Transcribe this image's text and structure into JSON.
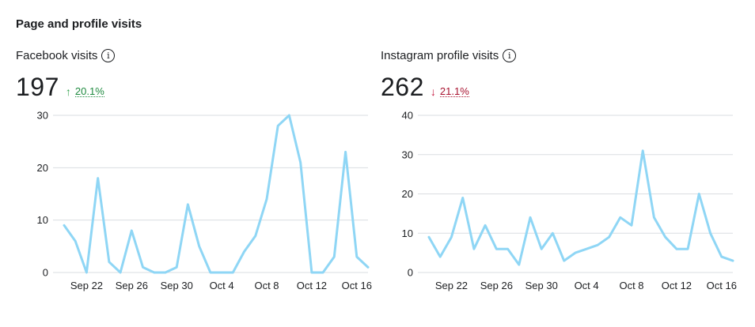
{
  "section": {
    "title": "Page and profile visits"
  },
  "icons": {
    "info": "info-icon",
    "arrow_up": "arrow-up-icon",
    "arrow_down": "arrow-down-icon"
  },
  "colors": {
    "line": "#8fd6f5",
    "positive": "#31a24c",
    "negative": "#c4173e"
  },
  "panels": [
    {
      "title": "Facebook visits",
      "value": "197",
      "delta": {
        "direction": "up",
        "arrow": "↑",
        "text": "20.1%"
      }
    },
    {
      "title": "Instagram profile visits",
      "value": "262",
      "delta": {
        "direction": "down",
        "arrow": "↓",
        "text": "21.1%"
      }
    }
  ],
  "chart_data": [
    {
      "type": "line",
      "title": "",
      "xlabel": "",
      "ylabel": "",
      "ylim": [
        0,
        30
      ],
      "yticks": [
        "0",
        "10",
        "20",
        "30"
      ],
      "ytick_values": [
        0,
        10,
        20,
        30
      ],
      "grid": true,
      "xticks": [
        "Sep 22",
        "Sep 26",
        "Sep 30",
        "Oct 4",
        "Oct 8",
        "Oct 12",
        "Oct 16"
      ],
      "xtick_indices": [
        2,
        6,
        10,
        14,
        18,
        22,
        26
      ],
      "x": [
        "Sep 20",
        "Sep 21",
        "Sep 22",
        "Sep 23",
        "Sep 24",
        "Sep 25",
        "Sep 26",
        "Sep 27",
        "Sep 28",
        "Sep 29",
        "Sep 30",
        "Oct 1",
        "Oct 2",
        "Oct 3",
        "Oct 4",
        "Oct 5",
        "Oct 6",
        "Oct 7",
        "Oct 8",
        "Oct 9",
        "Oct 10",
        "Oct 11",
        "Oct 12",
        "Oct 13",
        "Oct 14",
        "Oct 15",
        "Oct 16",
        "Oct 17"
      ],
      "series": [
        {
          "values": [
            9,
            6,
            0,
            18,
            2,
            0,
            8,
            1,
            0,
            0,
            1,
            13,
            5,
            0,
            0,
            0,
            4,
            7,
            14,
            28,
            30,
            21,
            0,
            0,
            3,
            23,
            3,
            1
          ]
        }
      ]
    },
    {
      "type": "line",
      "title": "",
      "xlabel": "",
      "ylabel": "",
      "ylim": [
        0,
        40
      ],
      "yticks": [
        "0",
        "10",
        "20",
        "30",
        "40"
      ],
      "ytick_values": [
        0,
        10,
        20,
        30,
        40
      ],
      "grid": true,
      "xticks": [
        "Sep 22",
        "Sep 26",
        "Sep 30",
        "Oct 4",
        "Oct 8",
        "Oct 12",
        "Oct 16"
      ],
      "xtick_indices": [
        2,
        6,
        10,
        14,
        18,
        22,
        26
      ],
      "x": [
        "Sep 20",
        "Sep 21",
        "Sep 22",
        "Sep 23",
        "Sep 24",
        "Sep 25",
        "Sep 26",
        "Sep 27",
        "Sep 28",
        "Sep 29",
        "Sep 30",
        "Oct 1",
        "Oct 2",
        "Oct 3",
        "Oct 4",
        "Oct 5",
        "Oct 6",
        "Oct 7",
        "Oct 8",
        "Oct 9",
        "Oct 10",
        "Oct 11",
        "Oct 12",
        "Oct 13",
        "Oct 14",
        "Oct 15",
        "Oct 16",
        "Oct 17"
      ],
      "series": [
        {
          "values": [
            9,
            4,
            9,
            19,
            6,
            12,
            6,
            6,
            2,
            14,
            6,
            10,
            3,
            5,
            6,
            7,
            9,
            14,
            12,
            31,
            14,
            9,
            6,
            6,
            20,
            10,
            4,
            3
          ]
        }
      ]
    }
  ]
}
